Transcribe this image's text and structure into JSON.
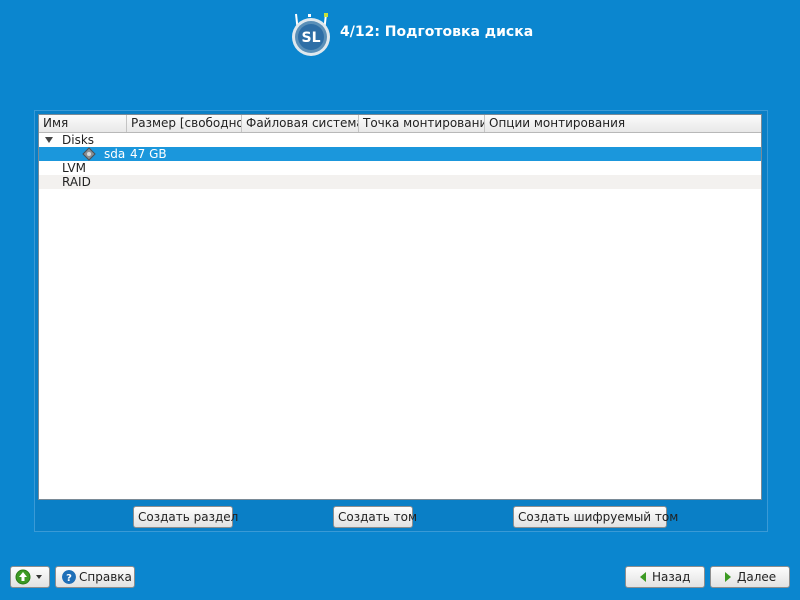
{
  "header": {
    "title": "4/12: Подготовка диска",
    "logo_text": "SL"
  },
  "table": {
    "columns": [
      "Имя",
      "Размер [свободно]",
      "Файловая система",
      "Точка монтирования",
      "Опции монтирования"
    ],
    "rows": [
      {
        "name": "Disks",
        "expanded": true
      },
      {
        "name": "sda",
        "size": "47 GB",
        "icon": "disk-icon",
        "selected": true
      },
      {
        "name": "LVM"
      },
      {
        "name": "RAID"
      }
    ]
  },
  "actions": {
    "create_partition": "Создать раздел",
    "create_volume": "Создать том",
    "create_encrypted_volume": "Создать шифруемый том"
  },
  "footer": {
    "help_label": "Справка",
    "back_label": "Назад",
    "next_label": "Далее"
  },
  "colors": {
    "background": "#0b86cf",
    "selection": "#1b97dc",
    "nav_arrow": "#3c9a23"
  }
}
